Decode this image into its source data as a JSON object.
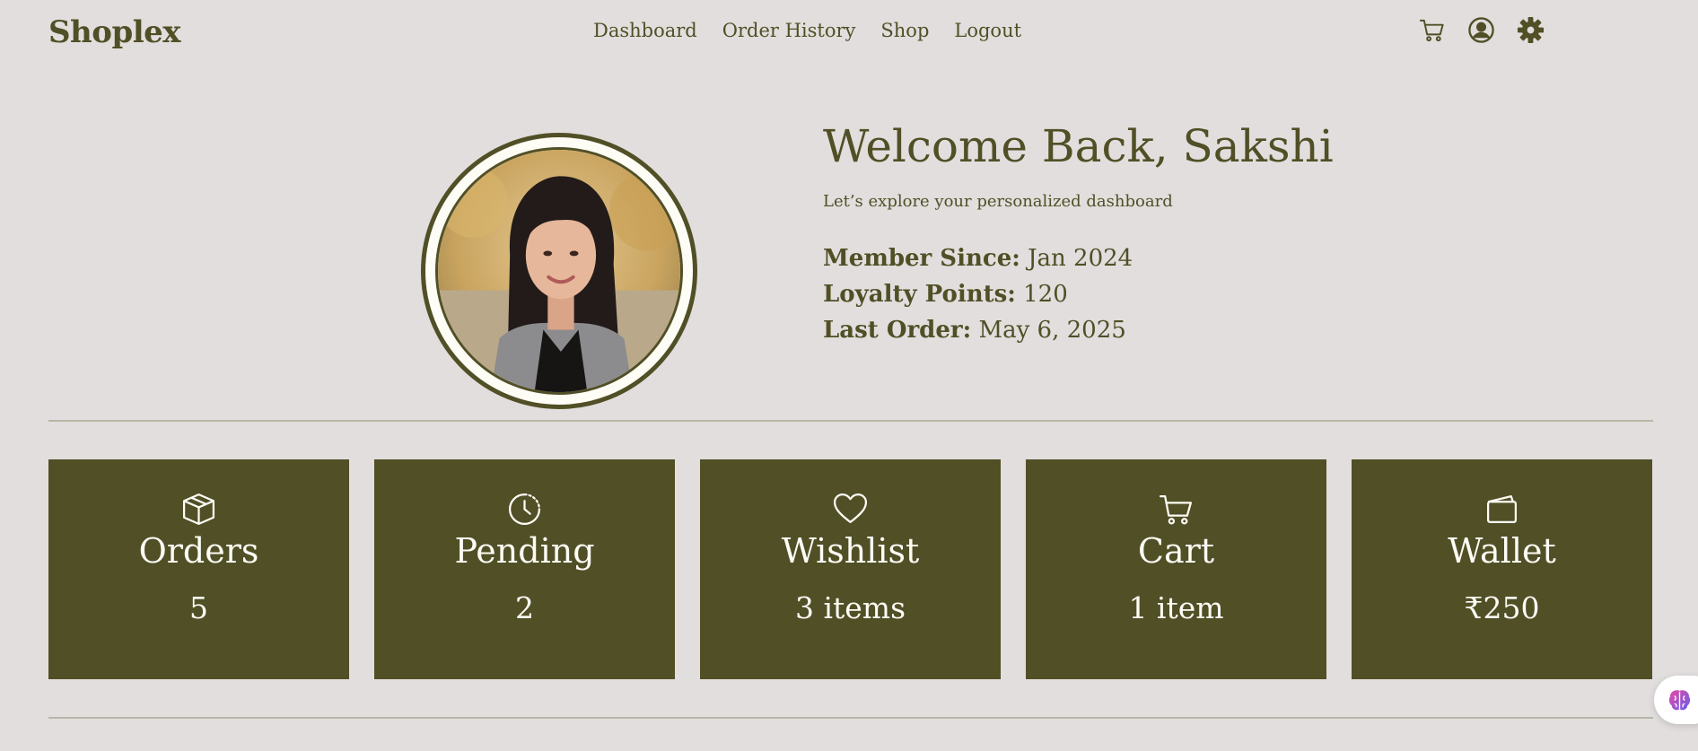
{
  "header": {
    "brand": "Shoplex",
    "nav": [
      "Dashboard",
      "Order History",
      "Shop",
      "Logout"
    ],
    "icons": [
      "cart-icon",
      "user-icon",
      "gear-icon"
    ]
  },
  "profile": {
    "welcome": "Welcome Back, Sakshi",
    "subtitle": "Let’s explore your personalized dashboard",
    "member_since_label": "Member Since:",
    "member_since_value": "Jan 2024",
    "loyalty_label": "Loyalty Points:",
    "loyalty_value": "120",
    "last_order_label": "Last Order:",
    "last_order_value": "May 6, 2025"
  },
  "cards": [
    {
      "title": "Orders",
      "value": "5",
      "icon": "box-icon"
    },
    {
      "title": "Pending",
      "value": "2",
      "icon": "clock-icon"
    },
    {
      "title": "Wishlist",
      "value": "3 items",
      "icon": "heart-icon"
    },
    {
      "title": "Cart",
      "value": "1 item",
      "icon": "cart-icon"
    },
    {
      "title": "Wallet",
      "value": "₹250",
      "icon": "wallet-icon"
    }
  ],
  "colors": {
    "background": "#e1dedd",
    "accent": "#514f26",
    "card_text": "#fdfcf5"
  }
}
